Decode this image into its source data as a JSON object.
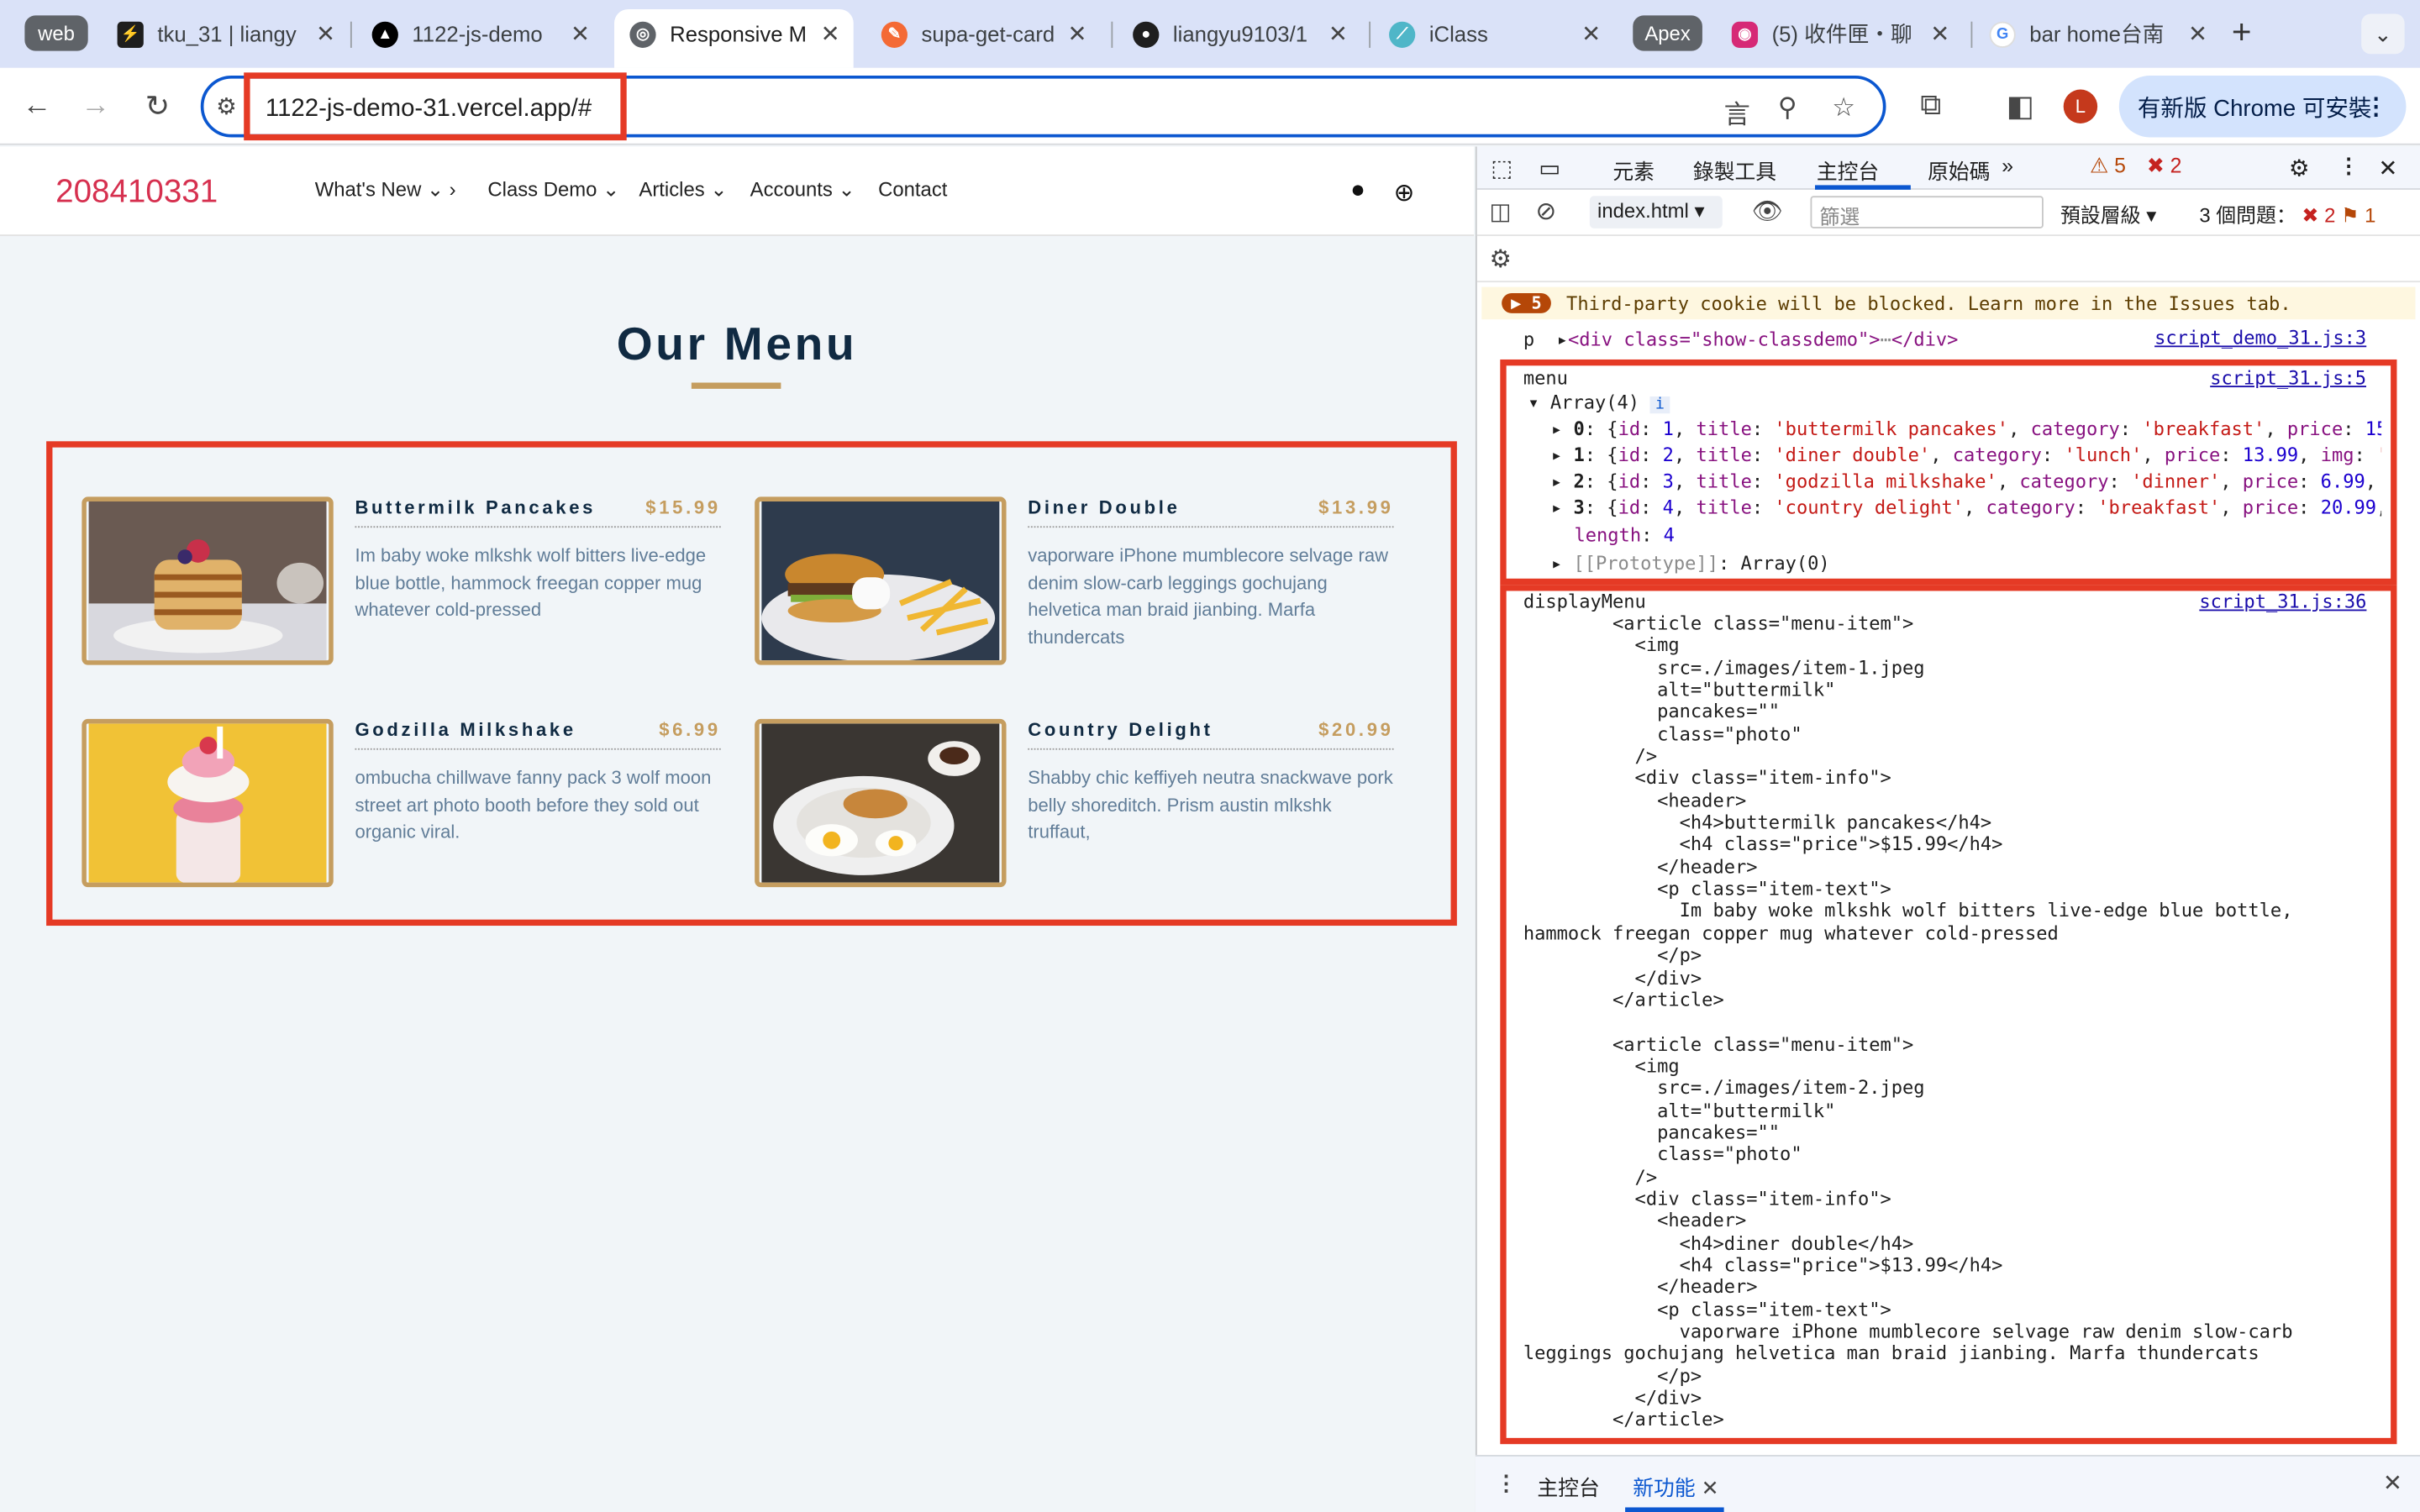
{
  "tabs": {
    "group": "web",
    "t1": "tku_31 | liangy",
    "t2": "1122-js-demo",
    "t3": "Responsive M",
    "t4": "supa-get-card",
    "t5": "liangyu9103/1",
    "t6": "iClass",
    "group2": "Apex",
    "t7": "(5) 收件匣・聊",
    "t8": "bar home台南"
  },
  "toolbar": {
    "url": "1122-js-demo-31.vercel.app/#",
    "update": "有新版 Chrome 可安裝",
    "avatar": "L"
  },
  "site": {
    "logo": "208410331",
    "nav": [
      "What's New",
      "Class Demo",
      "Articles",
      "Accounts",
      "Contact"
    ],
    "heading": "Our Menu",
    "items": [
      {
        "title": "Buttermilk Pancakes",
        "price": "$15.99",
        "text": "Im baby woke mlkshk wolf bitters live-edge blue bottle, hammock freegan copper mug whatever cold-pressed"
      },
      {
        "title": "Diner Double",
        "price": "$13.99",
        "text": "vaporware iPhone mumblecore selvage raw denim slow-carb leggings gochujang helvetica man braid jianbing. Marfa thundercats"
      },
      {
        "title": "Godzilla Milkshake",
        "price": "$6.99",
        "text": "ombucha chillwave fanny pack 3 wolf moon street art photo booth before they sold out organic viral."
      },
      {
        "title": "Country Delight",
        "price": "$20.99",
        "text": "Shabby chic keffiyeh neutra snackwave pork belly shoreditch. Prism austin mlkshk truffaut,"
      }
    ]
  },
  "devtools": {
    "tabs": [
      "元素",
      "錄製工具",
      "主控台",
      "原始碼"
    ],
    "warn": "5",
    "err": "2",
    "ctx": "index.html",
    "filter": "篩選",
    "level": "預設層級",
    "issues": "3 個問題：",
    "ierr": "2",
    "iwarn": "1",
    "cookie_count": "5",
    "cookie": "Third-party cookie will be blocked. Learn more in the Issues tab.",
    "p_label": "p",
    "p_node": "<div class=\"show-classdemo\">",
    "p_end": "</div>",
    "src1": "script_demo_31.js:3",
    "menu_label": "menu",
    "src2": "script_31.js:5",
    "arr": "Array(4)",
    "length_key": "length",
    "length_val": "4",
    "proto_key": "[[Prototype]]",
    "proto_val": "Array(0)",
    "display_label": "displayMenu",
    "src3": "script_31.js:36",
    "html_out": "        <article class=\"menu-item\">\n          <img\n            src=./images/item-1.jpeg\n            alt=\"buttermilk\"\n            pancakes=\"\"\n            class=\"photo\"\n          />\n          <div class=\"item-info\">\n            <header>\n              <h4>buttermilk pancakes</h4>\n              <h4 class=\"price\">$15.99</h4>\n            </header>\n            <p class=\"item-text\">\n              Im baby woke mlkshk wolf bitters live-edge blue bottle,\nhammock freegan copper mug whatever cold-pressed\n            </p>\n          </div>\n        </article>\n\n        <article class=\"menu-item\">\n          <img\n            src=./images/item-2.jpeg\n            alt=\"buttermilk\"\n            pancakes=\"\"\n            class=\"photo\"\n          />\n          <div class=\"item-info\">\n            <header>\n              <h4>diner double</h4>\n              <h4 class=\"price\">$13.99</h4>\n            </header>\n            <p class=\"item-text\">\n              vaporware iPhone mumblecore selvage raw denim slow-carb\nleggings gochujang helvetica man braid jianbing. Marfa thundercats\n            </p>\n          </div>\n        </article>",
    "bottom_tabs": [
      "主控台",
      "新功能"
    ]
  }
}
